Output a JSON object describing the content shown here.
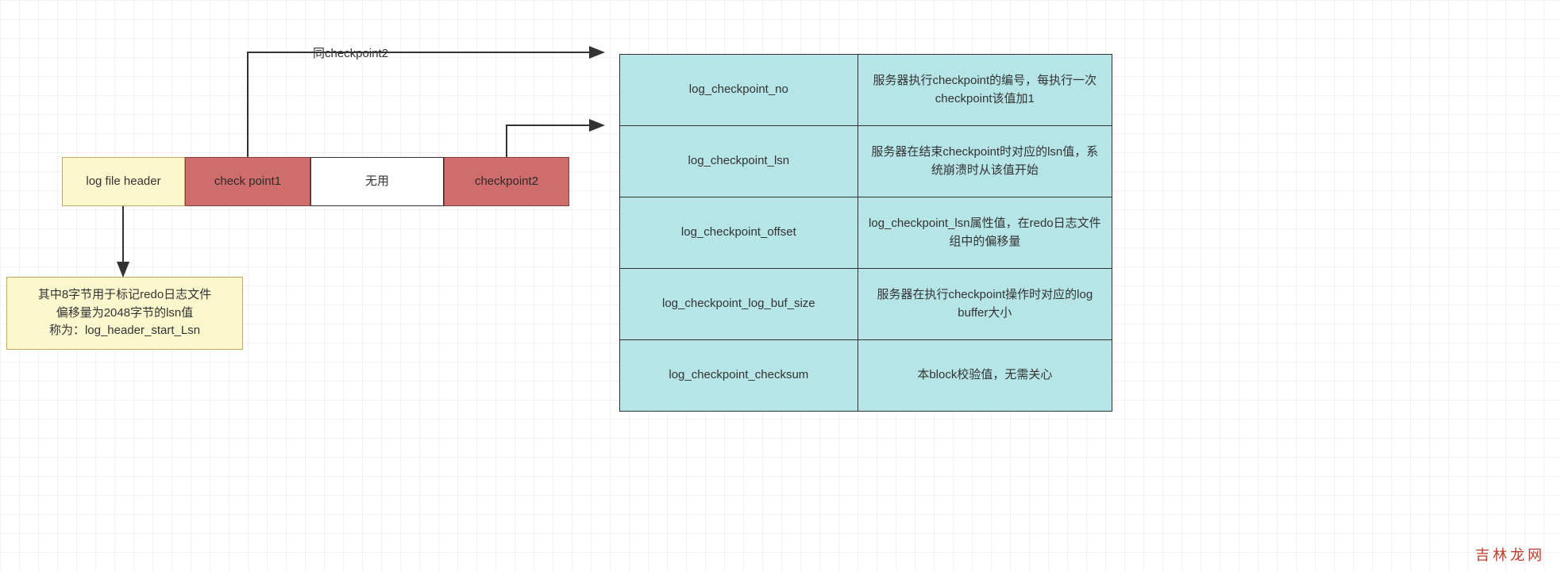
{
  "blocks": {
    "log_file_header": "log file header",
    "checkpoint1": "check point1",
    "unused": "无用",
    "checkpoint2": "checkpoint2"
  },
  "note_lsn": {
    "line1": "其中8字节用于标记redo日志文件",
    "line2": "偏移量为2048字节的lsn值",
    "line3": "称为：log_header_start_Lsn"
  },
  "annotation_same_checkpoint2": "同checkpoint2",
  "checkpoint_fields": [
    {
      "name": "log_checkpoint_no",
      "desc": "服务器执行checkpoint的编号，每执行一次checkpoint该值加1"
    },
    {
      "name": "log_checkpoint_lsn",
      "desc": "服务器在结束checkpoint时对应的lsn值，系统崩溃时从该值开始"
    },
    {
      "name": "log_checkpoint_offset",
      "desc": "log_checkpoint_lsn属性值，在redo日志文件组中的偏移量"
    },
    {
      "name": "log_checkpoint_log_buf_size",
      "desc": "服务器在执行checkpoint操作时对应的log buffer大小"
    },
    {
      "name": "log_checkpoint_checksum",
      "desc": "本block校验值，无需关心"
    }
  ],
  "watermark": "吉林龙网"
}
